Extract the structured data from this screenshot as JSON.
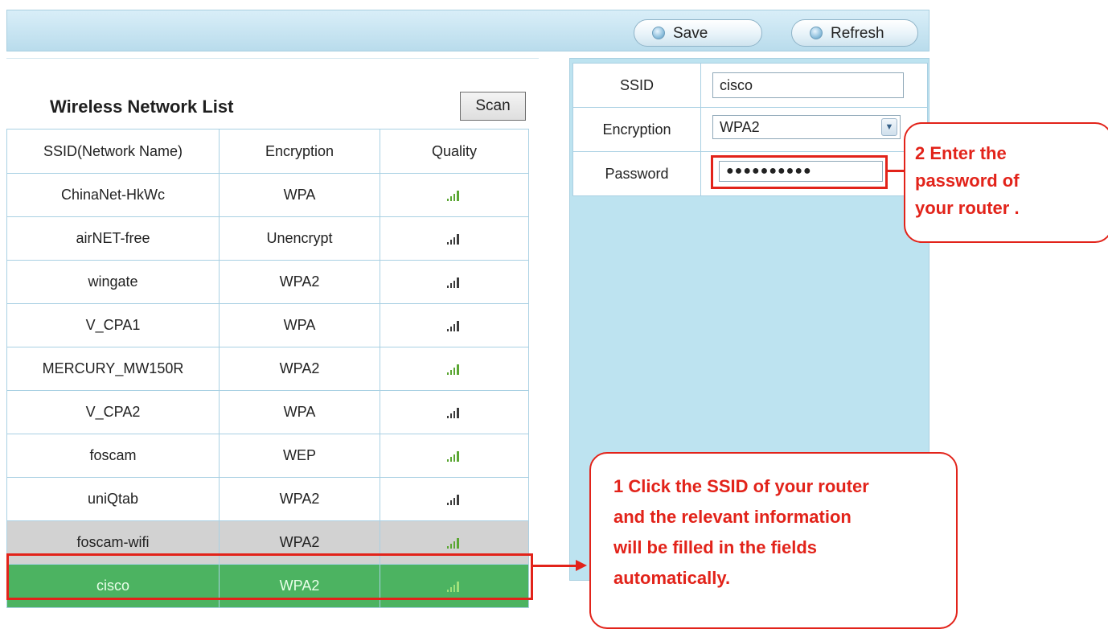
{
  "toolbar": {
    "save_label": "Save",
    "refresh_label": "Refresh"
  },
  "network_list": {
    "title": "Wireless Network List",
    "scan_label": "Scan",
    "columns": [
      "SSID(Network Name)",
      "Encryption",
      "Quality"
    ],
    "rows": [
      {
        "ssid": "ChinaNet-HkWc",
        "encryption": "WPA",
        "quality_icon": "signal-strength-icon",
        "quality_color": "#5aa632"
      },
      {
        "ssid": "airNET-free",
        "encryption": "Unencrypt",
        "quality_icon": "signal-strength-icon",
        "quality_color": "#3b3b3b"
      },
      {
        "ssid": "wingate",
        "encryption": "WPA2",
        "quality_icon": "signal-strength-icon",
        "quality_color": "#3b3b3b"
      },
      {
        "ssid": "V_CPA1",
        "encryption": "WPA",
        "quality_icon": "signal-strength-icon",
        "quality_color": "#3b3b3b"
      },
      {
        "ssid": "MERCURY_MW150R",
        "encryption": "WPA2",
        "quality_icon": "signal-strength-icon",
        "quality_color": "#5aa632"
      },
      {
        "ssid": "V_CPA2",
        "encryption": "WPA",
        "quality_icon": "signal-strength-icon",
        "quality_color": "#3b3b3b"
      },
      {
        "ssid": "foscam",
        "encryption": "WEP",
        "quality_icon": "signal-strength-icon",
        "quality_color": "#5aa632"
      },
      {
        "ssid": "uniQtab",
        "encryption": "WPA2",
        "quality_icon": "signal-strength-icon",
        "quality_color": "#3b3b3b"
      },
      {
        "ssid": "foscam-wifi",
        "encryption": "WPA2",
        "quality_icon": "signal-strength-icon",
        "quality_color": "#5aa632"
      },
      {
        "ssid": "cisco",
        "encryption": "WPA2",
        "quality_icon": "signal-strength-icon",
        "quality_color": "#9fe07a"
      }
    ],
    "hovered_row": "foscam-wifi",
    "selected_row": "cisco"
  },
  "form": {
    "ssid_label": "SSID",
    "ssid_value": "cisco",
    "encryption_label": "Encryption",
    "encryption_value": "WPA2",
    "password_label": "Password",
    "password_value": "●●●●●●●●●●"
  },
  "annotations": {
    "callout_password": [
      "2 Enter the",
      "password of",
      "your router ."
    ],
    "callout_ssid": [
      "1 Click the SSID of your router",
      "and the relevant information",
      "will be filled in the fields",
      "automatically."
    ],
    "color": "#e2231a"
  },
  "colors": {
    "panel_blue": "#bde3f0",
    "selected_row": "#4cb361",
    "hover_row": "#d2d2d2"
  }
}
